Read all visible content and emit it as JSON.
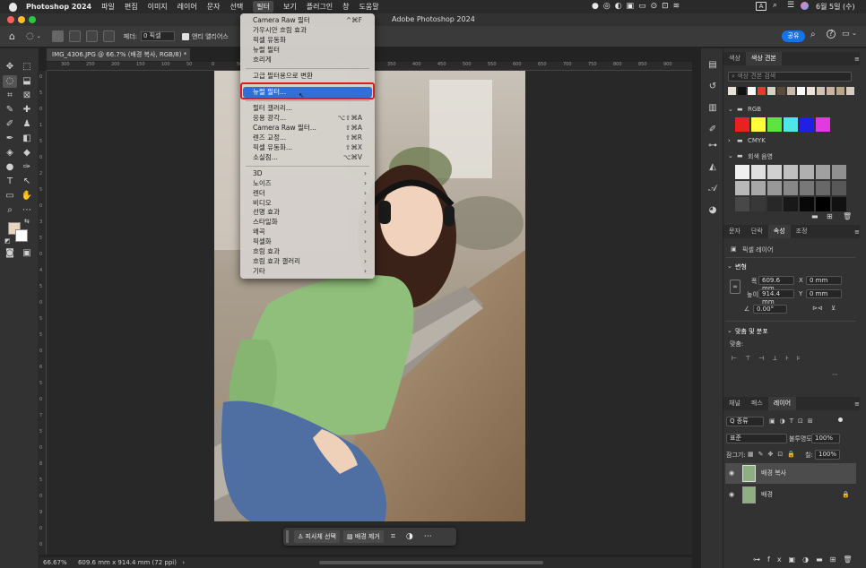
{
  "menubar": {
    "app": "Photoshop 2024",
    "items": [
      "파일",
      "편집",
      "이미지",
      "레이어",
      "문자",
      "선택",
      "필터",
      "보기",
      "플러그인",
      "창",
      "도움말"
    ],
    "active_index": 6,
    "datetime": "6월 5일 (수)"
  },
  "window": {
    "title": "Adobe Photoshop 2024"
  },
  "options": {
    "feather_label": "페더:",
    "feather_value": "0 픽셀",
    "antialias_label": "앤티 앨리어스",
    "share_label": "공유"
  },
  "document": {
    "tab_title": "IMG_4306.JPG @ 66.7% (배경 복사, RGB/8) *",
    "zoom": "66.67%",
    "info": "609.6 mm x 914.4 mm (72 ppi)",
    "ruler_h": [
      "300",
      "250",
      "200",
      "150",
      "100",
      "50",
      "0",
      "50",
      "100",
      "150",
      "200",
      "250",
      "300",
      "350",
      "400",
      "450",
      "500",
      "550",
      "600",
      "650",
      "700",
      "750",
      "800",
      "850",
      "900"
    ],
    "ruler_v": [
      "0",
      "5",
      "0",
      "1",
      "5",
      "0",
      "2",
      "5",
      "0",
      "3",
      "5",
      "0",
      "4",
      "5",
      "0",
      "5",
      "5",
      "0",
      "6",
      "5",
      "0",
      "7",
      "5",
      "0",
      "8",
      "5",
      "0",
      "9",
      "0",
      "0"
    ]
  },
  "context_bar": {
    "select_subject": "피사체 선택",
    "remove_bg": "배경 제거"
  },
  "filter_menu": {
    "items": [
      {
        "label": "Camera Raw 필터",
        "shortcut": "^⌘F",
        "type": "item"
      },
      {
        "label": "가우시안 흐림 효과",
        "type": "item"
      },
      {
        "label": "픽셀 유동화",
        "type": "item"
      },
      {
        "label": "뉴럴 필터",
        "type": "item"
      },
      {
        "label": "흐리게",
        "type": "item"
      },
      {
        "type": "sep"
      },
      {
        "label": "고급 필터용으로 변환",
        "type": "item"
      },
      {
        "type": "sep"
      },
      {
        "label": "뉴럴 필터...",
        "type": "highlight"
      },
      {
        "type": "sep"
      },
      {
        "label": "필터 갤러리...",
        "type": "item"
      },
      {
        "label": "응용 광각...",
        "shortcut": "⌥⇧⌘A",
        "type": "item"
      },
      {
        "label": "Camera Raw 필터...",
        "shortcut": "⇧⌘A",
        "type": "item"
      },
      {
        "label": "렌즈 교정...",
        "shortcut": "⇧⌘R",
        "type": "item"
      },
      {
        "label": "픽셀 유동화...",
        "shortcut": "⇧⌘X",
        "type": "item"
      },
      {
        "label": "소실점...",
        "shortcut": "⌥⌘V",
        "type": "item"
      },
      {
        "type": "sep"
      },
      {
        "label": "3D",
        "type": "sub"
      },
      {
        "label": "노이즈",
        "type": "sub"
      },
      {
        "label": "렌더",
        "type": "sub"
      },
      {
        "label": "비디오",
        "type": "sub"
      },
      {
        "label": "선명 효과",
        "type": "sub"
      },
      {
        "label": "스타일화",
        "type": "sub"
      },
      {
        "label": "왜곡",
        "type": "sub"
      },
      {
        "label": "픽셀화",
        "type": "sub"
      },
      {
        "label": "흐림 효과",
        "type": "sub"
      },
      {
        "label": "흐림 효과 갤러리",
        "type": "sub"
      },
      {
        "label": "기타",
        "type": "sub"
      }
    ]
  },
  "swatches_panel": {
    "tabs": [
      "색상",
      "색상 견본"
    ],
    "search_placeholder": "색상 견본 검색",
    "groups": [
      "RGB",
      "CMYK",
      "회색 음영"
    ],
    "recent_colors": [
      "#e8e2d6",
      "#111111",
      "#ffffff",
      "#e23a2e",
      "#d9cfc4",
      "#5a4a3a",
      "#c8b8a8",
      "#ffffff",
      "#ece4d8",
      "#d2c2b2",
      "#c9b59f",
      "#bba48c",
      "#d8ccc0"
    ],
    "rgb_colors": [
      "#e8221e",
      "#ffff3a",
      "#5ee442",
      "#4ee6e6",
      "#1f1fe8",
      "#e03ae0"
    ],
    "gray_colors": [
      "#f0f0f0",
      "#e0e0e0",
      "#d0d0d0",
      "#c0c0c0",
      "#b0b0b0",
      "#a0a0a0",
      "#909090",
      "#b8b8b8",
      "#a8a8a8",
      "#989898",
      "#888888",
      "#787878",
      "#686868",
      "#585858",
      "#484848",
      "#383838",
      "#282828",
      "#181818",
      "#080808",
      "#000000",
      "#111111"
    ]
  },
  "properties_panel": {
    "tabs": [
      "문자",
      "단락",
      "속성",
      "조정"
    ],
    "active_tab": 2,
    "layer_type": "픽셀 레이어",
    "transform_label": "변형",
    "w_label": "폭",
    "w_value": "609.6 mm",
    "x_label": "X",
    "x_value": "0 mm",
    "h_label": "높이",
    "h_value": "914.4 mm",
    "y_label": "Y",
    "y_value": "0 mm",
    "angle_value": "0.00°",
    "align_label": "맞춤 및 분포",
    "align_sub": "맞춤:"
  },
  "layers_panel": {
    "tabs": [
      "채널",
      "패스",
      "레이어"
    ],
    "active_tab": 2,
    "filter_kind": "Q 종류",
    "blend_mode": "표준",
    "opacity_label": "불투명도:",
    "opacity_value": "100%",
    "lock_label": "잠그기:",
    "fill_label": "칠:",
    "fill_value": "100%",
    "layers": [
      {
        "name": "배경 복사",
        "selected": true,
        "locked": false
      },
      {
        "name": "배경",
        "selected": false,
        "locked": true
      }
    ]
  }
}
